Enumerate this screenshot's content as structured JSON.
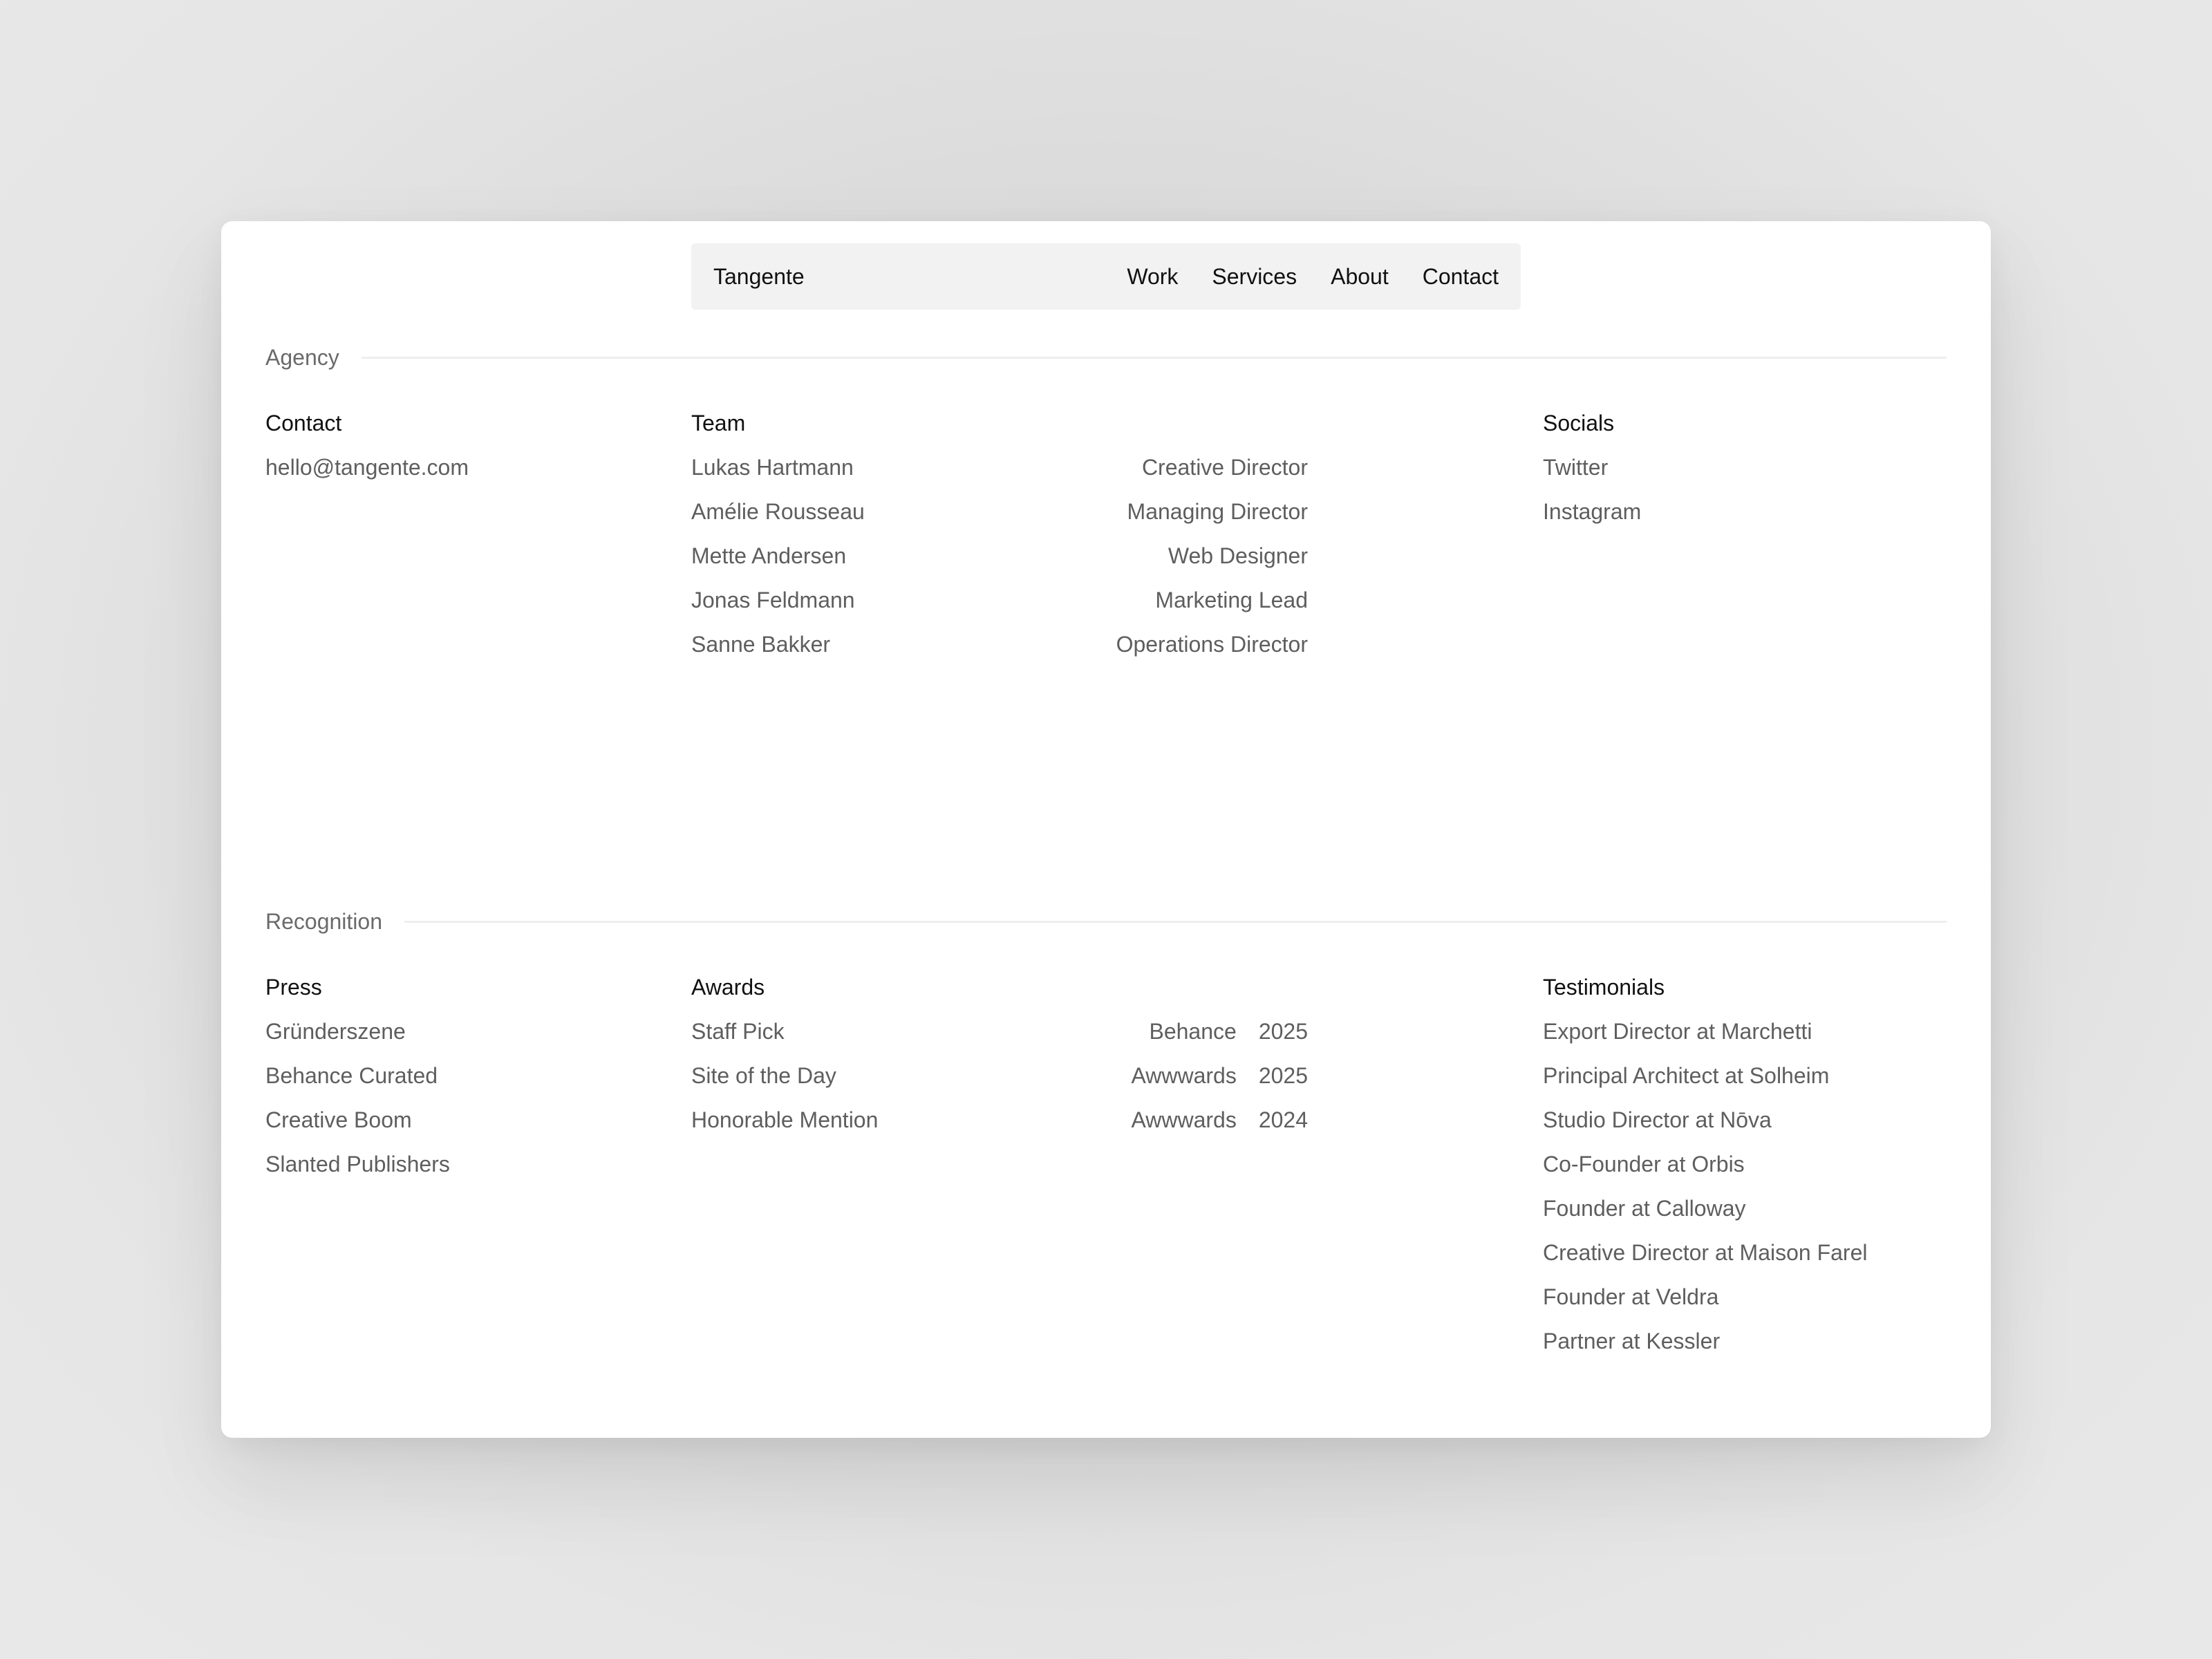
{
  "nav": {
    "brand": "Tangente",
    "links": [
      "Work",
      "Services",
      "About",
      "Contact"
    ]
  },
  "agency": {
    "section_title": "Agency",
    "contact": {
      "title": "Contact",
      "email": "hello@tangente.com"
    },
    "team": {
      "title": "Team",
      "members": [
        {
          "name": "Lukas Hartmann",
          "role": "Creative Director"
        },
        {
          "name": "Amélie Rousseau",
          "role": "Managing Director"
        },
        {
          "name": "Mette Andersen",
          "role": "Web Designer"
        },
        {
          "name": "Jonas Feldmann",
          "role": "Marketing Lead"
        },
        {
          "name": "Sanne Bakker",
          "role": "Operations Director"
        }
      ]
    },
    "socials": {
      "title": "Socials",
      "items": [
        "Twitter",
        "Instagram"
      ]
    }
  },
  "recognition": {
    "section_title": "Recognition",
    "press": {
      "title": "Press",
      "items": [
        "Gründerszene",
        "Behance Curated",
        "Creative Boom",
        "Slanted Publishers"
      ]
    },
    "awards": {
      "title": "Awards",
      "items": [
        {
          "name": "Staff Pick",
          "source": "Behance",
          "year": "2025"
        },
        {
          "name": "Site of the Day",
          "source": "Awwwards",
          "year": "2025"
        },
        {
          "name": "Honorable Mention",
          "source": "Awwwards",
          "year": "2024"
        }
      ]
    },
    "testimonials": {
      "title": "Testimonials",
      "items": [
        "Export Director at Marchetti",
        "Principal Architect at Solheim",
        "Studio Director at Nōva",
        "Co-Founder at Orbis",
        "Founder at Calloway",
        "Creative Director at Maison Farel",
        "Founder at Veldra",
        "Partner at Kessler"
      ]
    }
  }
}
